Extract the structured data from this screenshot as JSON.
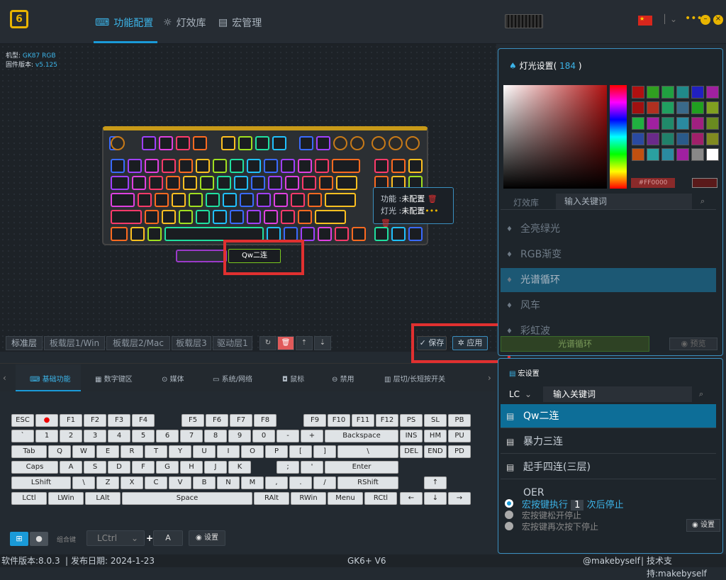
{
  "app": {
    "logo": "6"
  },
  "nav": {
    "tabs": [
      {
        "label": "功能配置"
      },
      {
        "label": "灯效库"
      },
      {
        "label": "宏管理"
      }
    ]
  },
  "device": {
    "model_label": "机型:",
    "model": "GK87 RGB",
    "fw_label": "固件版本:",
    "fw": "v5.125"
  },
  "popup": {
    "func_label": "功能 :",
    "func_value": "未配置",
    "light_label": "灯光 :",
    "light_value": "未配置"
  },
  "macro_slot": "Qw二连",
  "layers": [
    "标准层",
    "板载层1/Win",
    "板载层2/Mac",
    "板载层3",
    "驱动层1"
  ],
  "actions": {
    "save": "保存",
    "apply": "应用"
  },
  "func_tabs": [
    "基础功能",
    "数字键区",
    "媒体",
    "系统/网络",
    "鼠标",
    "禁用",
    "层切/长短按开关"
  ],
  "keys": {
    "row1": [
      "ESC",
      "●",
      "F1",
      "F2",
      "F3",
      "F4",
      "F5",
      "F6",
      "F7",
      "F8",
      "F9",
      "F10",
      "F11",
      "F12",
      "PS",
      "SL",
      "PB"
    ],
    "row2": [
      "`",
      "1",
      "2",
      "3",
      "4",
      "5",
      "6",
      "7",
      "8",
      "9",
      "0",
      "-",
      "+",
      "Backspace",
      "INS",
      "HM",
      "PU"
    ],
    "row3": [
      "Tab",
      "Q",
      "W",
      "E",
      "R",
      "T",
      "Y",
      "U",
      "I",
      "O",
      "P",
      "[",
      "]",
      "\\",
      "DEL",
      "END",
      "PD"
    ],
    "row4": [
      "Caps",
      "A",
      "S",
      "D",
      "F",
      "G",
      "H",
      "J",
      "K",
      ";",
      "'",
      "Enter"
    ],
    "row5": [
      "LShift",
      "\\",
      "Z",
      "X",
      "C",
      "V",
      "B",
      "N",
      "M",
      ",",
      ".",
      "/",
      "RShift",
      "↑"
    ],
    "row6": [
      "LCtl",
      "LWin",
      "LAlt",
      "Space",
      "RAlt",
      "RWin",
      "Menu",
      "RCtl",
      "←",
      "↓",
      "→"
    ]
  },
  "combo": {
    "label": "组合键",
    "select": "LCtrl",
    "plus": "+",
    "key": "A",
    "settings": "设置"
  },
  "light": {
    "title": "灯光设置(",
    "count": "184",
    "close": ")",
    "hex": "#FF0000",
    "tab": "灯效库",
    "search_placeholder": "输入关键词",
    "effects": [
      "全亮绿光",
      "RGB渐变",
      "光谱循环",
      "风车",
      "彩虹波"
    ],
    "selected": "光谱循环",
    "preview": "预览"
  },
  "macro": {
    "title": "宏设置",
    "filter": "LC",
    "search_placeholder": "输入关键词",
    "items": [
      "Qw二连",
      "暴力三连",
      "起手四连(三层)",
      "QER"
    ],
    "opt1_a": "宏按键执行",
    "opt1_n": "1",
    "opt1_b": "次后停止",
    "opt2": "宏按键松开停止",
    "opt3": "宏按键再次按下停止",
    "settings": "设置"
  },
  "status": {
    "version": "软件版本:8.0.3",
    "date": "发布日期: 2024-1-23",
    "device": "GK6+ V6",
    "credit": "@makebyself",
    "support": "技术支持:makebyself"
  },
  "colors": {
    "accent": "#3cb4e8",
    "highlight": "#e03030",
    "brand": "#e8b400"
  }
}
